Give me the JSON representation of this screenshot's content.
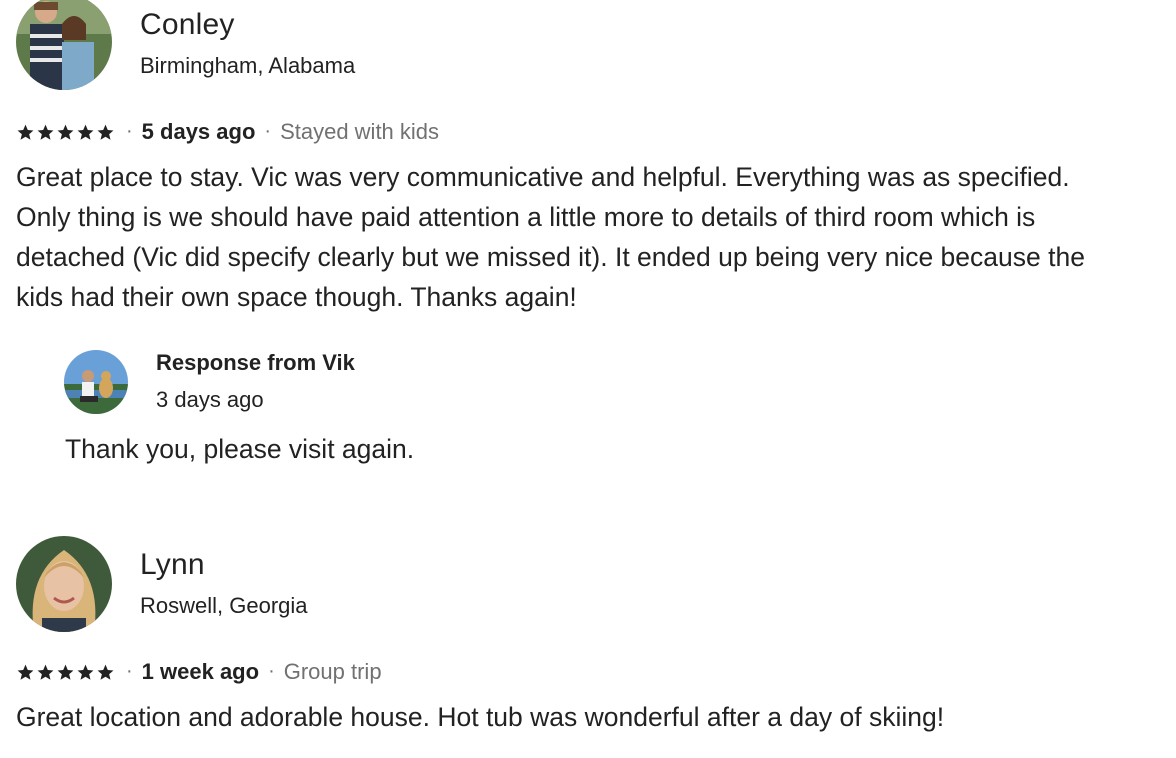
{
  "reviews": [
    {
      "name": "Conley",
      "location": "Birmingham, Alabama",
      "rating": 5,
      "separator": "·",
      "time_ago": "5 days ago",
      "trip_type": "Stayed with kids",
      "text": "Great place to stay. Vic was very communicative and helpful. Everything was as specified. Only thing is we should have paid attention a little more to details of third room which is detached (Vic did specify clearly but we missed it). It ended up being very nice because the kids had their own space though. Thanks again!",
      "response": {
        "title": "Response from Vik",
        "time_ago": "3 days ago",
        "text": "Thank you, please visit again."
      }
    },
    {
      "name": "Lynn",
      "location": "Roswell, Georgia",
      "rating": 5,
      "separator": "·",
      "time_ago": "1 week ago",
      "trip_type": "Group trip",
      "text": "Great location and adorable house. Hot tub was wonderful after a day of skiing!"
    }
  ],
  "colors": {
    "text": "#222222",
    "muted": "#717171",
    "star": "#222222"
  },
  "icons": {
    "star": "star-icon"
  }
}
